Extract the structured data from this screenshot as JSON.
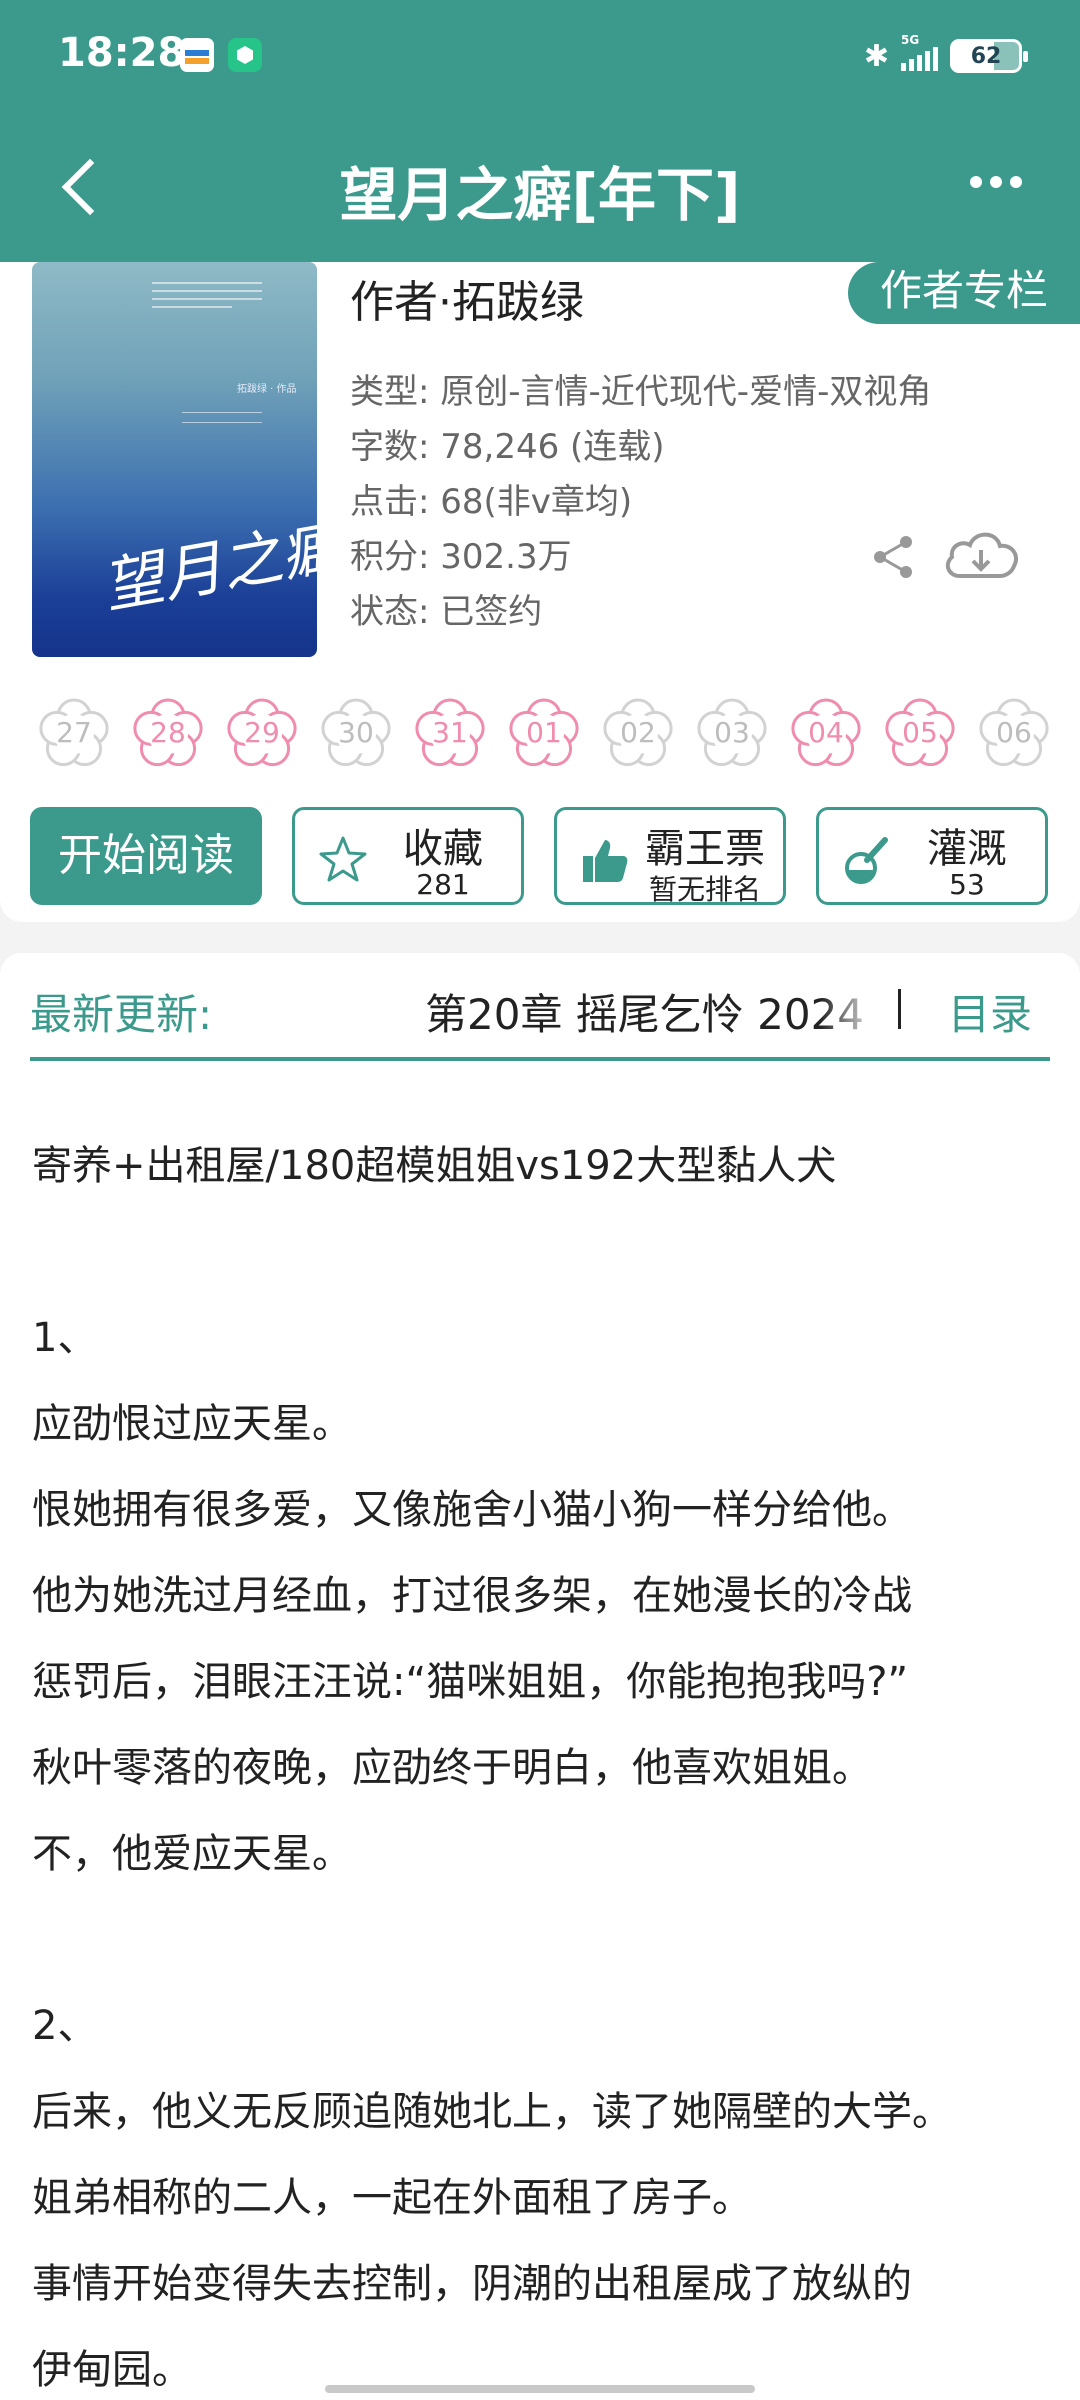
{
  "status_bar": {
    "time": "18:28",
    "network": "5G",
    "battery": "62"
  },
  "header": {
    "title": "望月之癖[年下]"
  },
  "book": {
    "author_label": "作者·",
    "author": "拓跋绿",
    "author_column_btn": "作者专栏",
    "cover": {
      "top_text": "拓跋绿 · 作品",
      "title_art": "望月之癖"
    },
    "meta": [
      {
        "label": "类型: ",
        "value": "原创-言情-近代现代-爱情-双视角"
      },
      {
        "label": "字数: ",
        "value": "78,246 (连载)"
      },
      {
        "label": "点击: ",
        "value": "68(非v章均)"
      },
      {
        "label": "积分: ",
        "value": "302.3万"
      },
      {
        "label": "状态: ",
        "value": "已签约"
      }
    ]
  },
  "flowers": [
    {
      "label": "27",
      "active": false
    },
    {
      "label": "28",
      "active": true
    },
    {
      "label": "29",
      "active": true
    },
    {
      "label": "30",
      "active": false
    },
    {
      "label": "31",
      "active": true
    },
    {
      "label": "01",
      "active": true
    },
    {
      "label": "02",
      "active": false
    },
    {
      "label": "03",
      "active": false
    },
    {
      "label": "04",
      "active": true
    },
    {
      "label": "05",
      "active": true
    },
    {
      "label": "06",
      "active": false
    }
  ],
  "actions": {
    "read": "开始阅读",
    "collect": {
      "label": "收藏",
      "count": "281"
    },
    "vote": {
      "label": "霸王票",
      "sub": "暂无排名"
    },
    "water": {
      "label": "灌溉",
      "count": "53"
    }
  },
  "update": {
    "label": "最新更新:",
    "chapter": "第20章 摇尾乞怜 2024",
    "toc": "目录"
  },
  "intro": [
    "寄养+出租屋/180超模姐姐vs192大型黏人犬",
    "",
    "1、",
    "应劭恨过应天星。",
    "恨她拥有很多爱，又像施舍小猫小狗一样分给他。",
    "他为她洗过月经血，打过很多架，在她漫长的冷战",
    "惩罚后，泪眼汪汪说:“猫咪姐姐，你能抱抱我吗?”",
    "秋叶零落的夜晚，应劭终于明白，他喜欢姐姐。",
    "不，他爱应天星。",
    "",
    "2、",
    "后来，他义无反顾追随她北上，读了她隔壁的大学。",
    "姐弟相称的二人，一起在外面租了房子。",
    "事情开始变得失去控制，阴潮的出租屋成了放纵的",
    "伊甸园。"
  ],
  "colors": {
    "primary": "#3c9a8d",
    "flower_active": "#f08cae",
    "flower_inactive": "#d2d2d2"
  }
}
